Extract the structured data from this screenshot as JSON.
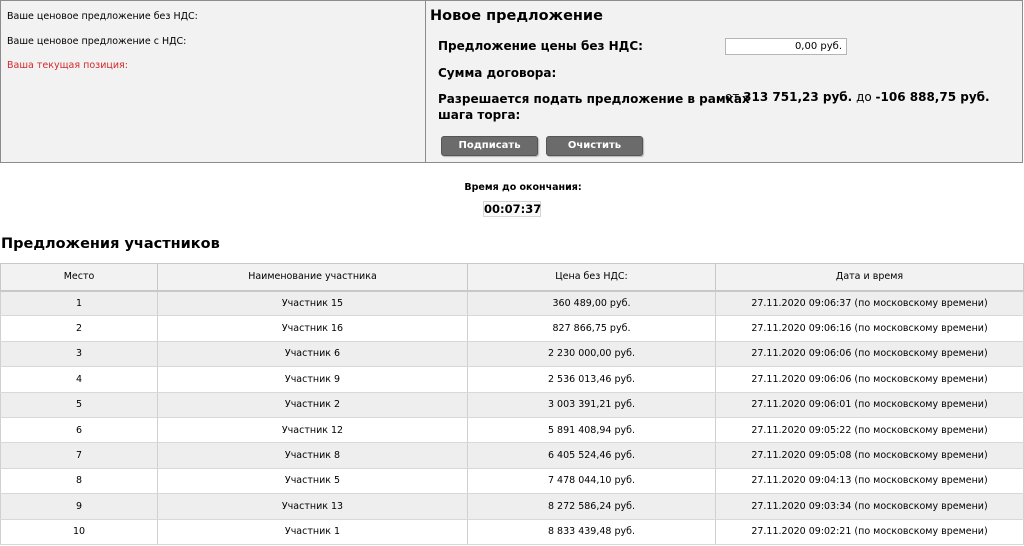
{
  "bid_info": {
    "price_without_vat_label": "Ваше ценовое предложение без НДС:",
    "price_with_vat_label": "Ваше ценовое предложение с НДС:",
    "current_position_label": "Ваша текущая позиция:"
  },
  "new_offer": {
    "title": "Новое предложение",
    "price_label": "Предложение цены без НДС:",
    "price_value": "0,00 руб.",
    "contract_sum_label": "Сумма договора:",
    "step_label_line1": "Разрешается подать предложение в рамках",
    "step_label_line2": "шага торга:",
    "step_from_word": "от",
    "step_from_value": "313 751,23 руб.",
    "step_to_word": "до",
    "step_to_value": "-106 888,75 руб.",
    "sign_button": "Подписать",
    "clear_button": "Очистить"
  },
  "timer": {
    "label": "Время до окончания:",
    "value": "00:07:37"
  },
  "offers": {
    "title": "Предложения участников",
    "columns": [
      "Место",
      "Наименование участника",
      "Цена без НДС:",
      "Дата и время"
    ],
    "rows": [
      {
        "place": "1",
        "participant": "Участник 15",
        "price": "360 489,00 руб.",
        "datetime": "27.11.2020 09:06:37 (по московскому времени)"
      },
      {
        "place": "2",
        "participant": "Участник 16",
        "price": "827 866,75 руб.",
        "datetime": "27.11.2020 09:06:16 (по московскому времени)"
      },
      {
        "place": "3",
        "participant": "Участник 6",
        "price": "2 230 000,00 руб.",
        "datetime": "27.11.2020 09:06:06 (по московскому времени)"
      },
      {
        "place": "4",
        "participant": "Участник 9",
        "price": "2 536 013,46 руб.",
        "datetime": "27.11.2020 09:06:06 (по московскому времени)"
      },
      {
        "place": "5",
        "participant": "Участник 2",
        "price": "3 003 391,21 руб.",
        "datetime": "27.11.2020 09:06:01 (по московскому времени)"
      },
      {
        "place": "6",
        "participant": "Участник 12",
        "price": "5 891 408,94 руб.",
        "datetime": "27.11.2020 09:05:22 (по московскому времени)"
      },
      {
        "place": "7",
        "participant": "Участник 8",
        "price": "6 405 524,46 руб.",
        "datetime": "27.11.2020 09:05:08 (по московскому времени)"
      },
      {
        "place": "8",
        "participant": "Участник 5",
        "price": "7 478 044,10 руб.",
        "datetime": "27.11.2020 09:04:13 (по московскому времени)"
      },
      {
        "place": "9",
        "participant": "Участник 13",
        "price": "8 272 586,24 руб.",
        "datetime": "27.11.2020 09:03:34 (по московскому времени)"
      },
      {
        "place": "10",
        "participant": "Участник 1",
        "price": "8 833 439,48 руб.",
        "datetime": "27.11.2020 09:02:21 (по московскому времени)"
      }
    ]
  },
  "colors": {
    "panel_bg": "#f2f2f2",
    "position_red": "#d3292b",
    "button_bg": "#6b6b6b",
    "row_alt_bg": "#eeeeee"
  }
}
